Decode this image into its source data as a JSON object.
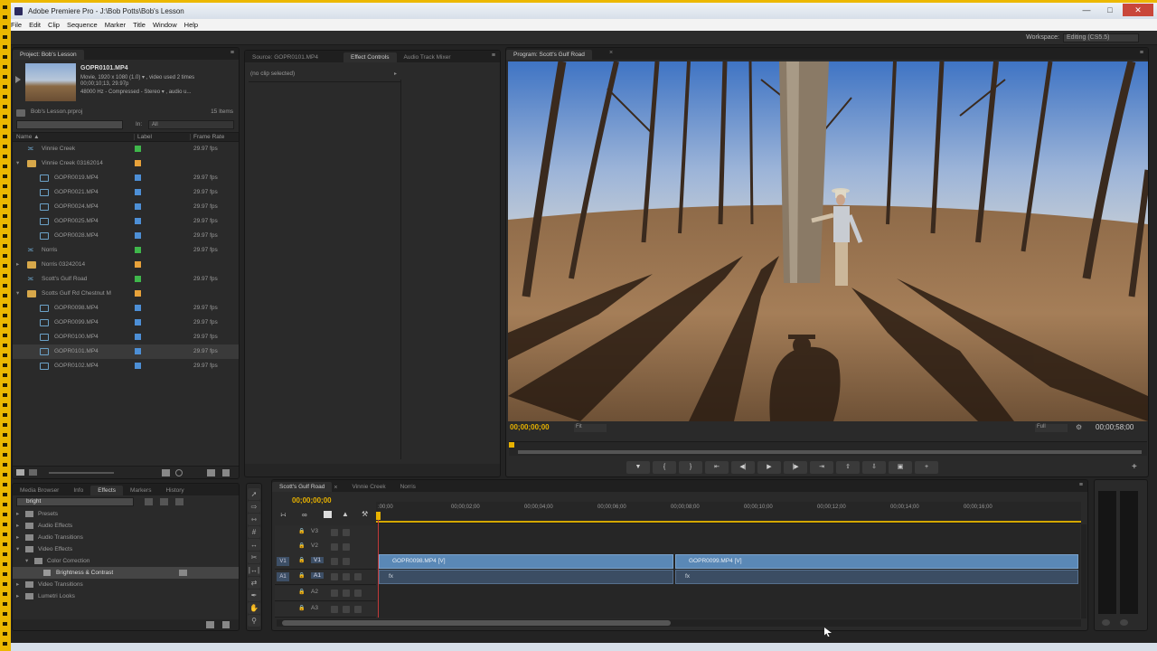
{
  "window": {
    "title": "Adobe Premiere Pro - J:\\Bob Potts\\Bob's Lesson"
  },
  "menu": [
    "File",
    "Edit",
    "Clip",
    "Sequence",
    "Marker",
    "Title",
    "Window",
    "Help"
  ],
  "workspace": {
    "label": "Workspace:",
    "value": "Editing (CS5.5)"
  },
  "project": {
    "tab": "Project: Bob's Lesson",
    "selected_clip": "GOPR0101.MP4",
    "clip_info": [
      "Movie, 1920 x 1080 (1.0) ▾ , video used 2 times",
      "00;00;10;13, 29.97p",
      "48000 Hz - Compressed - Stereo ▾ , audio u..."
    ],
    "project_name": "Bob's Lesson.prproj",
    "item_count": "15 Items",
    "in_label": "In:",
    "in_value": "All",
    "columns": {
      "name": "Name ▲",
      "label": "Label",
      "frame_rate": "Frame Rate"
    },
    "items": [
      {
        "name": "Vinnie Creek",
        "type": "sequence",
        "level": 0,
        "color": "#3fb74b",
        "rate": "29.97 fps"
      },
      {
        "name": "Vinnie Creek 03162014",
        "type": "folder",
        "level": 0,
        "expanded": true,
        "color": "#e8a23a",
        "rate": ""
      },
      {
        "name": "GOPR0019.MP4",
        "type": "clip",
        "level": 1,
        "color": "#4d8fd6",
        "rate": "29.97 fps"
      },
      {
        "name": "GOPR0021.MP4",
        "type": "clip",
        "level": 1,
        "color": "#4d8fd6",
        "rate": "29.97 fps"
      },
      {
        "name": "GOPR0024.MP4",
        "type": "clip",
        "level": 1,
        "color": "#4d8fd6",
        "rate": "29.97 fps"
      },
      {
        "name": "GOPR0025.MP4",
        "type": "clip",
        "level": 1,
        "color": "#4d8fd6",
        "rate": "29.97 fps"
      },
      {
        "name": "GOPR0028.MP4",
        "type": "clip",
        "level": 1,
        "color": "#4d8fd6",
        "rate": "29.97 fps"
      },
      {
        "name": "Norris",
        "type": "sequence",
        "level": 0,
        "color": "#3fb74b",
        "rate": "29.97 fps"
      },
      {
        "name": "Norris 03242014",
        "type": "folder",
        "level": 0,
        "expanded": false,
        "color": "#e8a23a",
        "rate": ""
      },
      {
        "name": "Scott's Gulf Road",
        "type": "sequence",
        "level": 0,
        "color": "#3fb74b",
        "rate": "29.97 fps"
      },
      {
        "name": "Scotts Gulf Rd Chestnut M",
        "type": "folder",
        "level": 0,
        "expanded": true,
        "color": "#e8a23a",
        "rate": ""
      },
      {
        "name": "GOPR0098.MP4",
        "type": "clip",
        "level": 1,
        "color": "#4d8fd6",
        "rate": "29.97 fps"
      },
      {
        "name": "GOPR0099.MP4",
        "type": "clip",
        "level": 1,
        "color": "#4d8fd6",
        "rate": "29.97 fps"
      },
      {
        "name": "GOPR0100.MP4",
        "type": "clip",
        "level": 1,
        "color": "#4d8fd6",
        "rate": "29.97 fps"
      },
      {
        "name": "GOPR0101.MP4",
        "type": "clip",
        "level": 1,
        "color": "#4d8fd6",
        "rate": "29.97 fps",
        "selected": true
      },
      {
        "name": "GOPR0102.MP4",
        "type": "clip",
        "level": 1,
        "color": "#4d8fd6",
        "rate": "29.97 fps"
      }
    ]
  },
  "effects_panel": {
    "tabs": [
      "Media Browser",
      "Info",
      "Effects",
      "Markers",
      "History"
    ],
    "active_tab": "Effects",
    "search": "bright",
    "tree": [
      {
        "label": "Presets",
        "level": 0,
        "kind": "folder",
        "expanded": false
      },
      {
        "label": "Audio Effects",
        "level": 0,
        "kind": "folder",
        "expanded": false
      },
      {
        "label": "Audio Transitions",
        "level": 0,
        "kind": "folder",
        "expanded": false
      },
      {
        "label": "Video Effects",
        "level": 0,
        "kind": "folder",
        "expanded": true
      },
      {
        "label": "Color Correction",
        "level": 1,
        "kind": "folder",
        "expanded": true
      },
      {
        "label": "Brightness & Contrast",
        "level": 2,
        "kind": "effect",
        "selected": true
      },
      {
        "label": "Video Transitions",
        "level": 0,
        "kind": "folder",
        "expanded": false
      },
      {
        "label": "Lumetri Looks",
        "level": 0,
        "kind": "folder",
        "expanded": false
      }
    ]
  },
  "source_panel": {
    "tabs": [
      "Source: GOPR0101.MP4",
      "Effect Controls",
      "Audio Track Mixer"
    ],
    "active_tab": "Effect Controls",
    "message": "(no clip selected)"
  },
  "program": {
    "tab": "Program: Scott's Gulf Road",
    "timecode": "00;00;00;00",
    "fit": "Fit",
    "quality": "Full",
    "duration": "00;00;58;00"
  },
  "timeline": {
    "tabs": [
      "Scott's Gulf Road",
      "Vinnie Creek",
      "Norris"
    ],
    "active_tab": "Scott's Gulf Road",
    "timecode": "00;00;00;00",
    "ruler": [
      ":00;00",
      "00;00;02;00",
      "00;00;04;00",
      "00;00;06;00",
      "00;00;08;00",
      "00;00;10;00",
      "00;00;12;00",
      "00;00;14;00",
      "00;00;16;00"
    ],
    "tracks": [
      {
        "name": "V3",
        "kind": "video"
      },
      {
        "name": "V2",
        "kind": "video"
      },
      {
        "name": "V1",
        "kind": "video",
        "source": "V1"
      },
      {
        "name": "A1",
        "kind": "audio",
        "source": "A1"
      },
      {
        "name": "A2",
        "kind": "audio"
      },
      {
        "name": "A3",
        "kind": "audio"
      }
    ],
    "video_clips": [
      "GOPR0098.MP4 [V]",
      "GOPR0099.MP4 [V]"
    ],
    "audio_clips": [
      "fx",
      "fx"
    ]
  },
  "colors": {
    "accent": "#ecb800",
    "timecode": "#e8b200",
    "clip_video": "#5a88b6",
    "label_green": "#3fb74b",
    "label_blue": "#4d8fd6",
    "label_orange": "#e8a23a"
  }
}
